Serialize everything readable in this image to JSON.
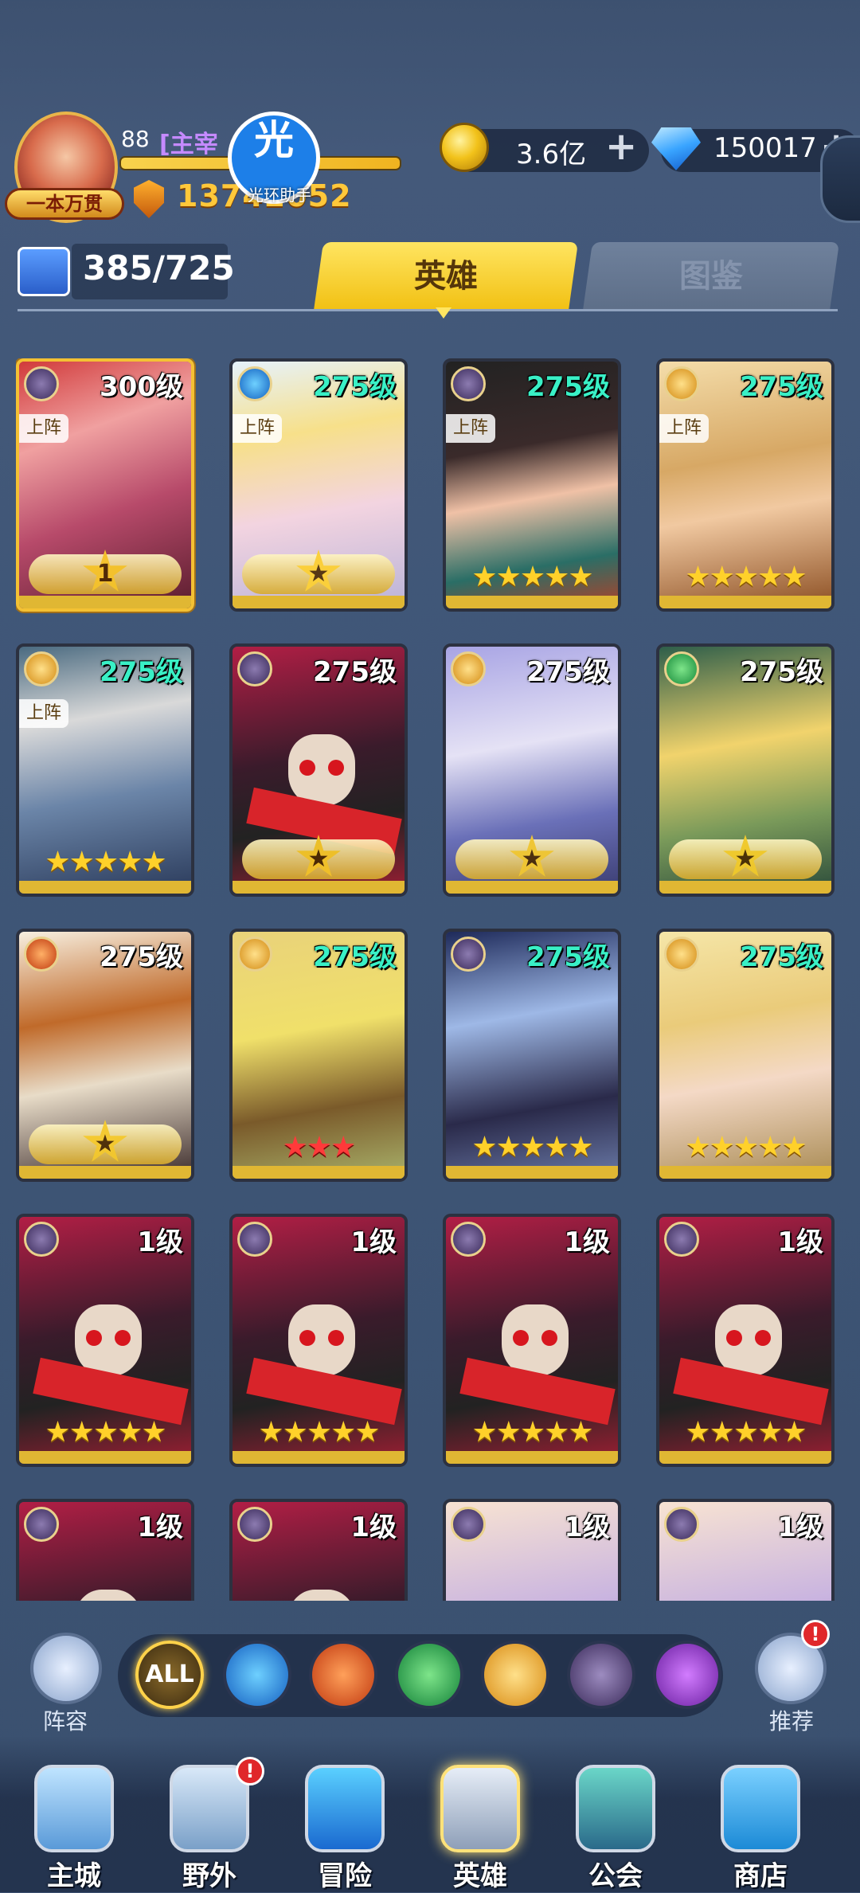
{
  "player": {
    "level": "88",
    "name": "[主宰",
    "vip_title": "一本万贯",
    "power": "13742052"
  },
  "watermark": {
    "main": "光",
    "sub": "光环助手"
  },
  "resources": {
    "gold": "3.6亿",
    "gems": "150017",
    "plus": "+"
  },
  "collection": {
    "count": "385/725"
  },
  "tabs": {
    "heroes": "英雄",
    "codex": "图鉴"
  },
  "heroes": [
    {
      "level": "300级",
      "element": "dark",
      "on_team": "上阵",
      "stars": "",
      "wing_text": "1"
    },
    {
      "level": "275级",
      "element": "water",
      "on_team": "上阵",
      "stars": "",
      "wing_text": "★"
    },
    {
      "level": "275级",
      "element": "dark",
      "on_team": "上阵",
      "stars": "★★★★★",
      "wing_text": ""
    },
    {
      "level": "275级",
      "element": "light",
      "on_team": "上阵",
      "stars": "★★★★★",
      "wing_text": ""
    },
    {
      "level": "275级",
      "element": "light",
      "on_team": "上阵",
      "stars": "★★★★★",
      "wing_text": ""
    },
    {
      "level": "275级",
      "element": "dark",
      "on_team": "",
      "stars": "",
      "wing_text": "★"
    },
    {
      "level": "275级",
      "element": "light",
      "on_team": "",
      "stars": "",
      "wing_text": "★"
    },
    {
      "level": "275级",
      "element": "nature",
      "on_team": "",
      "stars": "",
      "wing_text": "★"
    },
    {
      "level": "275级",
      "element": "fire",
      "on_team": "",
      "stars": "",
      "wing_text": "★"
    },
    {
      "level": "275级",
      "element": "light",
      "on_team": "",
      "stars": "★★★",
      "wing_text": ""
    },
    {
      "level": "275级",
      "element": "dark",
      "on_team": "",
      "stars": "★★★★★",
      "wing_text": ""
    },
    {
      "level": "275级",
      "element": "light",
      "on_team": "",
      "stars": "★★★★★",
      "wing_text": ""
    },
    {
      "level": "1级",
      "element": "dark",
      "on_team": "",
      "stars": "★★★★★",
      "wing_text": ""
    },
    {
      "level": "1级",
      "element": "dark",
      "on_team": "",
      "stars": "★★★★★",
      "wing_text": ""
    },
    {
      "level": "1级",
      "element": "dark",
      "on_team": "",
      "stars": "★★★★★",
      "wing_text": ""
    },
    {
      "level": "1级",
      "element": "dark",
      "on_team": "",
      "stars": "★★★★★",
      "wing_text": ""
    },
    {
      "level": "1级",
      "element": "dark",
      "on_team": "",
      "stars": "",
      "wing_text": ""
    },
    {
      "level": "1级",
      "element": "dark",
      "on_team": "",
      "stars": "",
      "wing_text": ""
    },
    {
      "level": "1级",
      "element": "dark",
      "on_team": "",
      "stars": "",
      "wing_text": ""
    },
    {
      "level": "1级",
      "element": "dark",
      "on_team": "",
      "stars": "",
      "wing_text": ""
    }
  ],
  "filters": {
    "lineup_label": "阵容",
    "all_label": "ALL",
    "recommend_label": "推荐",
    "notify": "!"
  },
  "nav": [
    {
      "label": "主城",
      "icon": "castle-icon"
    },
    {
      "label": "野外",
      "icon": "portal-icon"
    },
    {
      "label": "冒险",
      "icon": "trident-icon"
    },
    {
      "label": "英雄",
      "icon": "helmet-icon"
    },
    {
      "label": "公会",
      "icon": "banner-icon"
    },
    {
      "label": "商店",
      "icon": "shop-icon"
    }
  ]
}
